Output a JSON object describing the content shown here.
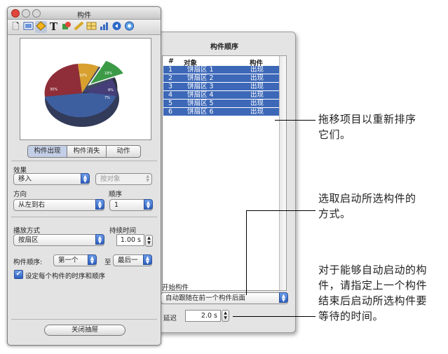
{
  "drawer": {
    "title": "构件顺序",
    "list_headers": {
      "num": "#",
      "object": "对象",
      "build": "构件"
    },
    "rows": [
      {
        "num": "1",
        "object": "饼扇区 1",
        "build": "出现"
      },
      {
        "num": "2",
        "object": "饼扇区 2",
        "build": "出现"
      },
      {
        "num": "3",
        "object": "饼扇区 3",
        "build": "出现"
      },
      {
        "num": "4",
        "object": "饼扇区 4",
        "build": "出现"
      },
      {
        "num": "5",
        "object": "饼扇区 5",
        "build": "出现"
      },
      {
        "num": "6",
        "object": "饼扇区 6",
        "build": "出现"
      }
    ],
    "start_build_label": "开始构件",
    "start_build_value": "自动跟随在前一个构件后面",
    "delay_label": "延迟",
    "delay_value": "2.0 s"
  },
  "inspector": {
    "title": "构件",
    "tabs": [
      "构件出现",
      "构件消失",
      "动作"
    ],
    "effect_label": "效果",
    "effect_value": "移入",
    "by_object_value": "按对象",
    "direction_label": "方向",
    "direction_value": "从左到右",
    "order_label": "顺序",
    "order_value": "1",
    "delivery_label": "播放方式",
    "delivery_value": "按扇区",
    "duration_label": "持续时间",
    "duration_value": "1.00 s",
    "build_order_label": "构件顺序:",
    "build_from_value": "第一个",
    "to_label": "至",
    "build_to_value": "最后一",
    "checkbox_label": "设定每个构件的时序和顺序",
    "close_button": "关闭抽屉"
  },
  "pie_labels": [
    "18%",
    "10%",
    "30%",
    "8%",
    "7%"
  ],
  "callouts": {
    "reorder": [
      "拖移项目以重新排序",
      "它们。"
    ],
    "choose": [
      "选取启动所选构件的",
      "方式。"
    ],
    "auto": [
      "对于能够自动启动的构",
      "件，请指定上一个构件",
      "结束后启动所选构件要",
      "等待的时间。"
    ]
  }
}
